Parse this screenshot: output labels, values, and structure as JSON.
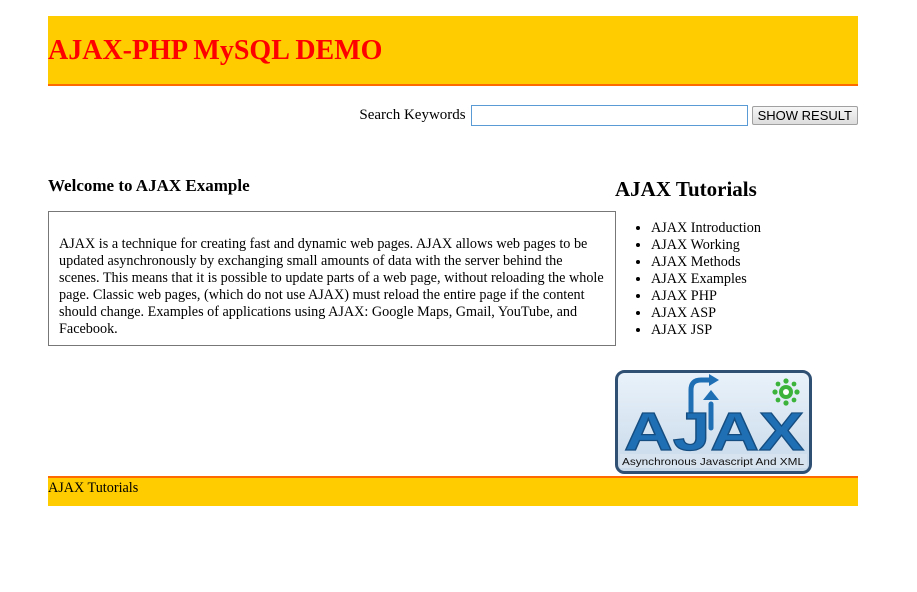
{
  "header": {
    "title": "AJAX-PHP MySQL DEMO"
  },
  "search": {
    "label": "Search Keywords",
    "value": "",
    "placeholder": "",
    "button_label": "SHOW RESULT"
  },
  "main": {
    "heading": "Welcome to AJAX Example",
    "body": "AJAX is a technique for creating fast and dynamic web pages. AJAX allows web pages to be updated asynchronously by exchanging small amounts of data with the server behind the scenes. This means that it is possible to update parts of a web page, without reloading the whole page. Classic web pages, (which do not use AJAX) must reload the entire page if the content should change. Examples of applications using AJAX: Google Maps, Gmail, YouTube, and Facebook."
  },
  "sidebar": {
    "heading": "AJAX Tutorials",
    "items": [
      {
        "label": "AJAX Introduction"
      },
      {
        "label": "AJAX Working"
      },
      {
        "label": "AJAX Methods"
      },
      {
        "label": "AJAX Examples"
      },
      {
        "label": "AJAX PHP"
      },
      {
        "label": "AJAX ASP"
      },
      {
        "label": "AJAX JSP"
      }
    ],
    "logo": {
      "icon": "ajax-logo",
      "wordmark": "AJAX",
      "tagline": "Asynchronous Javascript And XML"
    }
  },
  "footer": {
    "text": "AJAX Tutorials"
  },
  "colors": {
    "header_bg": "#ffcc00",
    "header_border": "#ff6a00",
    "title": "#ff0000",
    "logo_blue": "#1f6fb5",
    "logo_green": "#3cb43c"
  }
}
